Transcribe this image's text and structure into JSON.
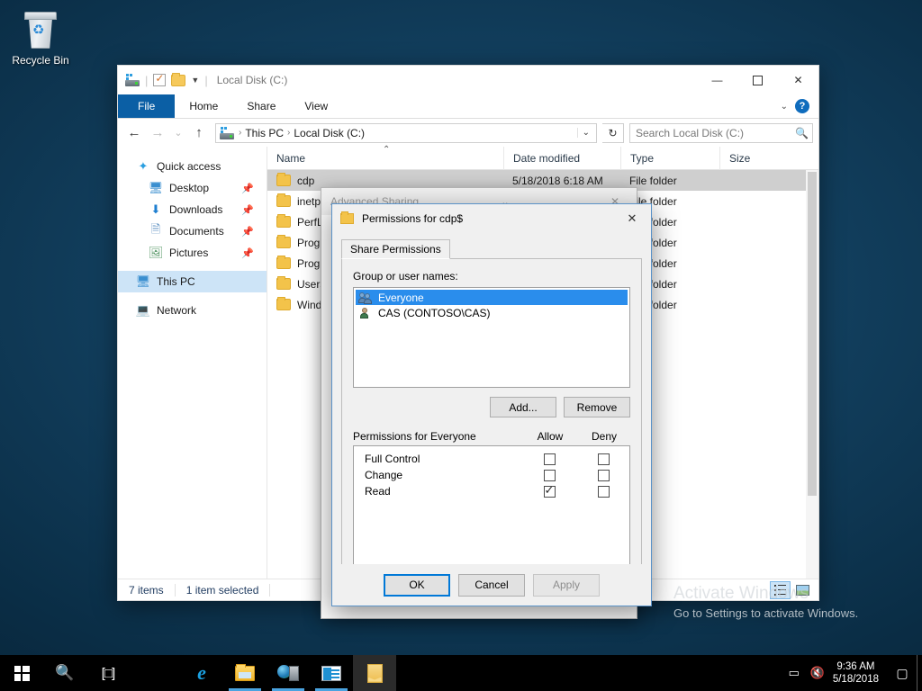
{
  "desktop": {
    "icons": [
      {
        "label": "Recycle Bin",
        "icon": "recycle-bin-icon"
      }
    ]
  },
  "explorer": {
    "title": "Local Disk (C:)",
    "quick_access_toolbar": [
      {
        "name": "drive-properties-icon"
      },
      {
        "name": "checkbox-icon"
      },
      {
        "name": "new-folder-icon"
      },
      {
        "name": "customize-caret-icon"
      }
    ],
    "window_controls": {
      "minimize": "—",
      "maximize": "☐",
      "close": "✕"
    },
    "ribbon": {
      "tabs": [
        {
          "label": "File",
          "active": true
        },
        {
          "label": "Home",
          "active": false
        },
        {
          "label": "Share",
          "active": false
        },
        {
          "label": "View",
          "active": false
        }
      ],
      "collapse_caret": "⌄",
      "help_label": "?"
    },
    "navigation": {
      "back": "←",
      "forward": "→",
      "recent": "⌄",
      "up": "↑",
      "breadcrumbs": [
        "This PC",
        "Local Disk (C:)"
      ],
      "breadcrumb_separator": "›",
      "dropdown_caret": "⌄",
      "refresh": "↻"
    },
    "search": {
      "placeholder": "Search Local Disk (C:)",
      "icon": "search-icon"
    },
    "navpane": {
      "items": [
        {
          "label": "Quick access",
          "icon": "star-icon",
          "indent": false,
          "pinned": false,
          "selected": false
        },
        {
          "label": "Desktop",
          "icon": "desktop-icon",
          "indent": true,
          "pinned": true,
          "selected": false
        },
        {
          "label": "Downloads",
          "icon": "downloads-icon",
          "indent": true,
          "pinned": true,
          "selected": false
        },
        {
          "label": "Documents",
          "icon": "documents-icon",
          "indent": true,
          "pinned": true,
          "selected": false
        },
        {
          "label": "Pictures",
          "icon": "pictures-icon",
          "indent": true,
          "pinned": true,
          "selected": false
        },
        {
          "label": "This PC",
          "icon": "this-pc-icon",
          "indent": false,
          "pinned": false,
          "selected": true
        },
        {
          "label": "Network",
          "icon": "network-icon",
          "indent": false,
          "pinned": false,
          "selected": false
        }
      ],
      "pin_glyph": "★"
    },
    "filelist": {
      "columns": [
        {
          "label": "Name",
          "sorted": "asc"
        },
        {
          "label": "Date modified"
        },
        {
          "label": "Type"
        },
        {
          "label": "Size"
        }
      ],
      "sort_caret": "⌃",
      "rows": [
        {
          "name": "cdp",
          "date_modified": "5/18/2018 6:18 AM",
          "type": "File folder",
          "size": "",
          "selected": true
        },
        {
          "name": "inetpub",
          "date_modified": "",
          "type": "File folder",
          "size": "",
          "selected": false
        },
        {
          "name": "PerfLogs",
          "date_modified": "",
          "type": "File folder",
          "size": "",
          "selected": false
        },
        {
          "name": "Program Files",
          "date_modified": "",
          "type": "File folder",
          "size": "",
          "selected": false
        },
        {
          "name": "Program Files (x86)",
          "date_modified": "",
          "type": "File folder",
          "size": "",
          "selected": false
        },
        {
          "name": "Users",
          "date_modified": "",
          "type": "File folder",
          "size": "",
          "selected": false
        },
        {
          "name": "Windows",
          "date_modified": "",
          "type": "File folder",
          "size": "",
          "selected": false
        }
      ]
    },
    "statusbar": {
      "item_count": "7 items",
      "selection_count": "1 item selected",
      "view_details": "details-view-button",
      "view_large_icons": "large-icons-view-button"
    }
  },
  "advanced_sharing_dialog": {
    "title": "Advanced Sharing",
    "close": "✕",
    "caret": "⌄"
  },
  "permissions_dialog": {
    "title": "Permissions for cdp$",
    "title_icon": "folder-icon",
    "close": "✕",
    "tabs": [
      {
        "label": "Share Permissions",
        "active": true
      }
    ],
    "group_label": "Group or user names:",
    "group_list": [
      {
        "label": "Everyone",
        "icon": "users-group-icon",
        "selected": true
      },
      {
        "label": "CAS (CONTOSO\\CAS)",
        "icon": "user-icon",
        "selected": false
      }
    ],
    "list_buttons": [
      {
        "label": "Add...",
        "disabled": false
      },
      {
        "label": "Remove",
        "disabled": false
      }
    ],
    "permissions_header": {
      "label": "Permissions for Everyone",
      "allow": "Allow",
      "deny": "Deny"
    },
    "permissions_rows": [
      {
        "label": "Full Control",
        "allow": false,
        "deny": false
      },
      {
        "label": "Change",
        "allow": false,
        "deny": false
      },
      {
        "label": "Read",
        "allow": true,
        "deny": false
      }
    ],
    "footer_buttons": [
      {
        "label": "OK",
        "default": true,
        "disabled": false
      },
      {
        "label": "Cancel",
        "default": false,
        "disabled": false
      },
      {
        "label": "Apply",
        "default": false,
        "disabled": true
      }
    ]
  },
  "activate_watermark": {
    "title": "Activate Windows",
    "subtitle": "Go to Settings to activate Windows."
  },
  "taskbar": {
    "buttons": [
      {
        "name": "start-button",
        "icon": "windows-logo-icon",
        "state": "idle"
      },
      {
        "name": "search-button",
        "icon": "search-icon",
        "state": "idle"
      },
      {
        "name": "task-view-button",
        "icon": "task-view-icon",
        "state": "idle"
      },
      {
        "name": "internet-explorer-button",
        "icon": "internet-explorer-icon",
        "state": "idle"
      },
      {
        "name": "file-explorer-button",
        "icon": "file-explorer-icon",
        "state": "running"
      },
      {
        "name": "server-manager-button",
        "icon": "server-manager-icon",
        "state": "running"
      },
      {
        "name": "apps-button",
        "icon": "apps-icon",
        "state": "running"
      },
      {
        "name": "explorer-window-button",
        "icon": "folder-icon",
        "state": "active"
      }
    ],
    "tray": {
      "icons": [
        {
          "name": "network-tray-icon",
          "glyph": "▭"
        },
        {
          "name": "volume-tray-icon",
          "glyph": "🔇"
        }
      ],
      "time": "9:36 AM",
      "date": "5/18/2018",
      "notification_icon": "▢",
      "show_desktop": "show-desktop-button"
    }
  }
}
